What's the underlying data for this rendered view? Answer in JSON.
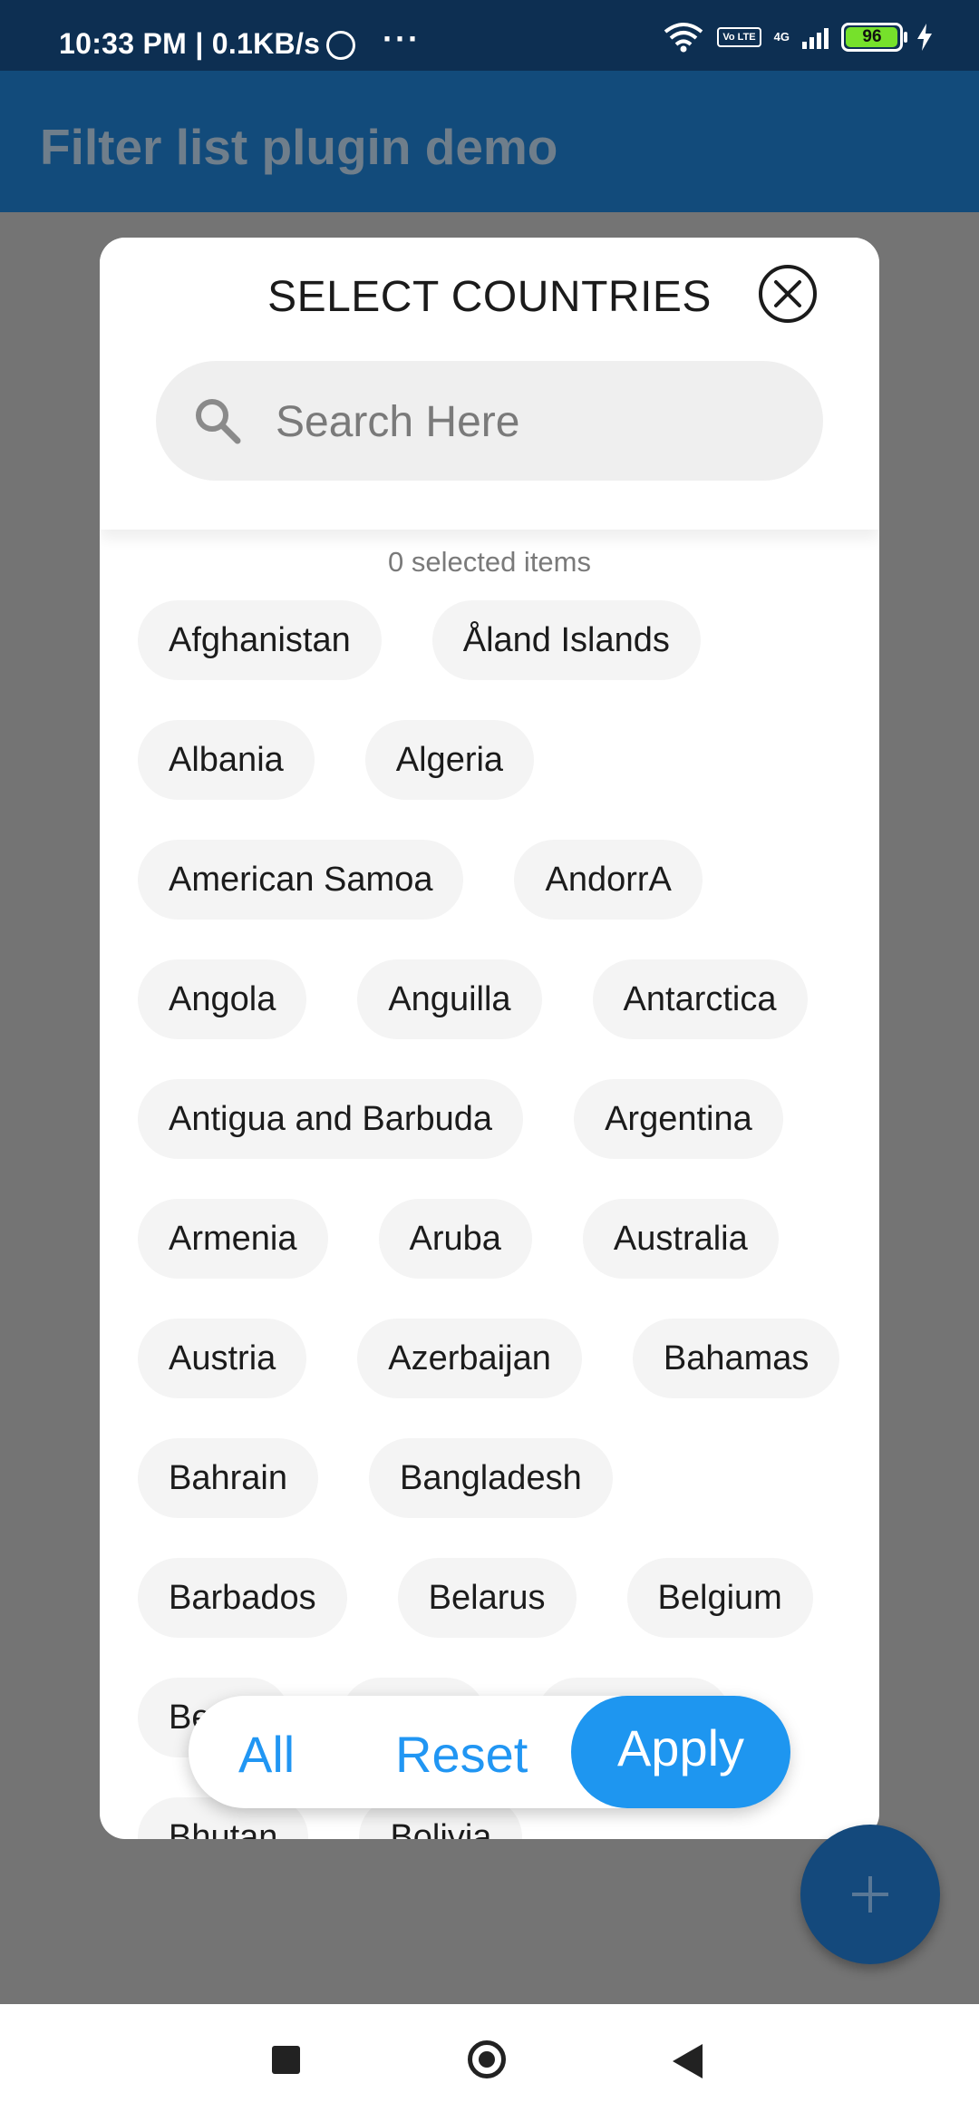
{
  "status_bar": {
    "time": "10:33 PM | 0.1KB/s",
    "dots": "···",
    "volte": "Vo LTE",
    "network": "4G",
    "battery": "96"
  },
  "app_bar": {
    "title": "Filter list plugin demo"
  },
  "dialog": {
    "title": "SELECT COUNTRIES",
    "search_placeholder": "Search Here",
    "selected_count": "0 selected items",
    "chips": [
      "Afghanistan",
      "Åland Islands",
      "Albania",
      "Algeria",
      "American Samoa",
      "AndorrA",
      "Angola",
      "Anguilla",
      "Antarctica",
      "Antigua and Barbuda",
      "Argentina",
      "Armenia",
      "Aruba",
      "Australia",
      "Austria",
      "Azerbaijan",
      "Bahamas",
      "Bahrain",
      "Bangladesh",
      "Barbados",
      "Belarus",
      "Belgium",
      "Be",
      "",
      "",
      "Bhutan",
      "Bolivia"
    ],
    "actions": {
      "all": "All",
      "reset": "Reset",
      "apply": "Apply"
    }
  },
  "colors": {
    "accent": "#2196f3",
    "app_bar": "#124b7b",
    "status_bar": "#0d2f52",
    "scrim": "#747474",
    "battery": "#76e12b"
  },
  "icons": [
    "alarm-icon",
    "wifi-icon",
    "signal-icon",
    "battery-icon",
    "charging-icon",
    "close-icon",
    "search-icon",
    "add-icon",
    "recents-icon",
    "home-icon",
    "back-icon"
  ]
}
